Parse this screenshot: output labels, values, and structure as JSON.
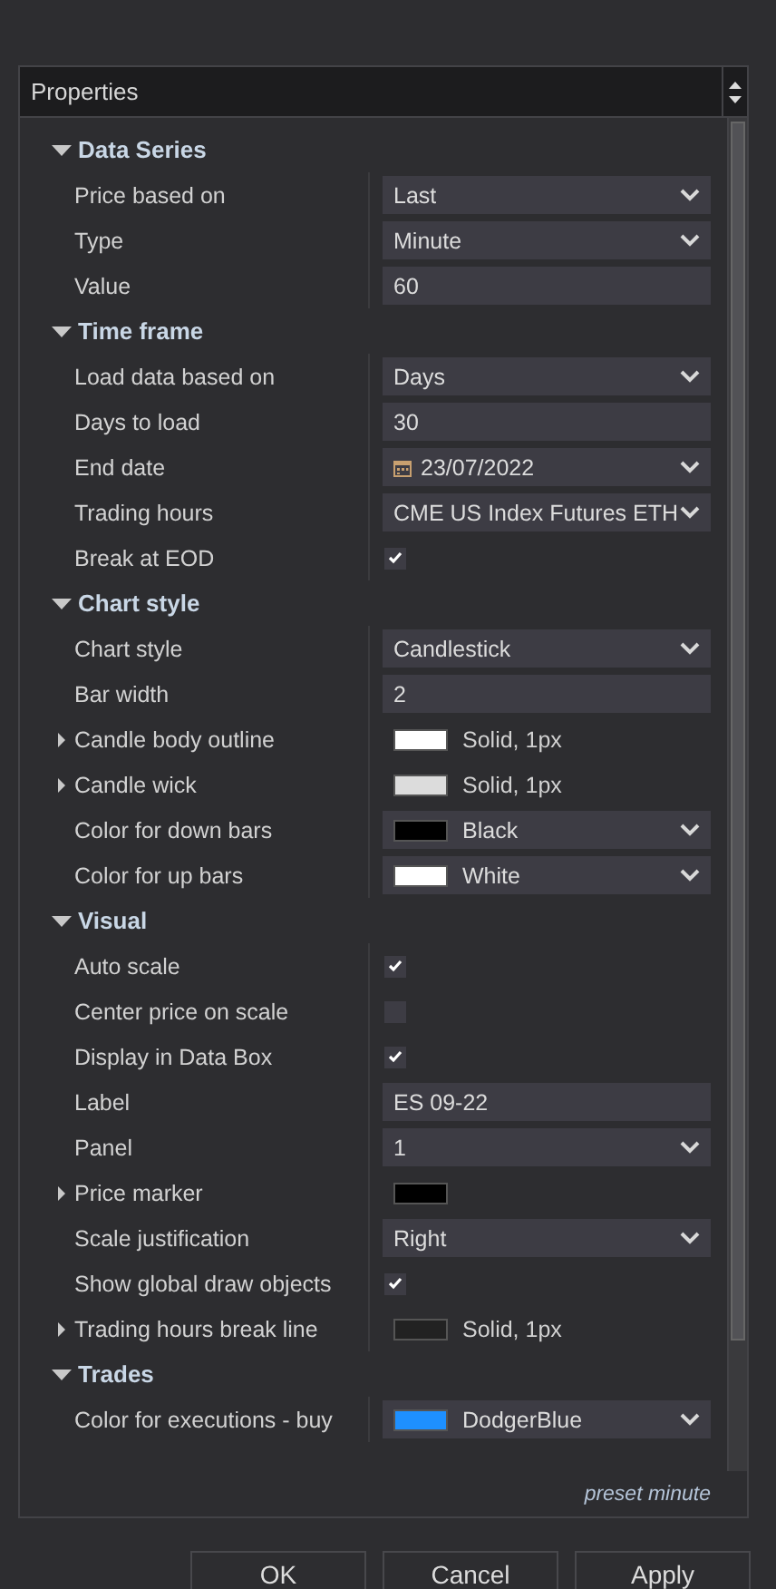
{
  "header": {
    "title": "Properties"
  },
  "sections": [
    {
      "title": "Data Series",
      "expanded": true,
      "rows": [
        {
          "kind": "dropdown",
          "label": "Price based on",
          "value": "Last"
        },
        {
          "kind": "dropdown",
          "label": "Type",
          "value": "Minute"
        },
        {
          "kind": "text",
          "label": "Value",
          "value": "60"
        }
      ]
    },
    {
      "title": "Time frame",
      "expanded": true,
      "rows": [
        {
          "kind": "dropdown",
          "label": "Load data based on",
          "value": "Days"
        },
        {
          "kind": "text",
          "label": "Days to load",
          "value": "30"
        },
        {
          "kind": "date",
          "label": "End date",
          "value": "23/07/2022"
        },
        {
          "kind": "dropdown",
          "label": "Trading hours",
          "value": "CME US Index Futures ETH"
        },
        {
          "kind": "checkbox",
          "label": "Break at EOD",
          "checked": true
        }
      ]
    },
    {
      "title": "Chart style",
      "expanded": true,
      "rows": [
        {
          "kind": "dropdown",
          "label": "Chart style",
          "value": "Candlestick"
        },
        {
          "kind": "text",
          "label": "Bar width",
          "value": "2"
        },
        {
          "kind": "stroke",
          "label": "Candle body outline",
          "expanded": false,
          "color": "#ffffff",
          "value": "Solid, 1px"
        },
        {
          "kind": "stroke",
          "label": "Candle wick",
          "expanded": false,
          "color": "#dcdcdc",
          "value": "Solid, 1px"
        },
        {
          "kind": "color",
          "label": "Color for down bars",
          "color": "#000000",
          "value": "Black"
        },
        {
          "kind": "color",
          "label": "Color for up bars",
          "color": "#ffffff",
          "value": "White"
        }
      ]
    },
    {
      "title": "Visual",
      "expanded": true,
      "rows": [
        {
          "kind": "checkbox",
          "label": "Auto scale",
          "checked": true
        },
        {
          "kind": "checkbox",
          "label": "Center price on scale",
          "checked": false
        },
        {
          "kind": "checkbox",
          "label": "Display in Data Box",
          "checked": true
        },
        {
          "kind": "text",
          "label": "Label",
          "value": "ES 09-22"
        },
        {
          "kind": "dropdown",
          "label": "Panel",
          "value": "1"
        },
        {
          "kind": "swatch",
          "label": "Price marker",
          "expanded": false,
          "color": "#000000"
        },
        {
          "kind": "dropdown",
          "label": "Scale justification",
          "value": "Right"
        },
        {
          "kind": "checkbox",
          "label": "Show global draw objects",
          "checked": true
        },
        {
          "kind": "stroke",
          "label": "Trading hours break line",
          "expanded": false,
          "color": "#222222",
          "value": "Solid, 1px"
        }
      ]
    },
    {
      "title": "Trades",
      "expanded": true,
      "rows": [
        {
          "kind": "color",
          "label": "Color for executions - buy",
          "color": "#1e90ff",
          "value": "DodgerBlue"
        }
      ]
    }
  ],
  "footer": "preset minute",
  "buttons": [
    "OK",
    "Cancel",
    "Apply"
  ]
}
